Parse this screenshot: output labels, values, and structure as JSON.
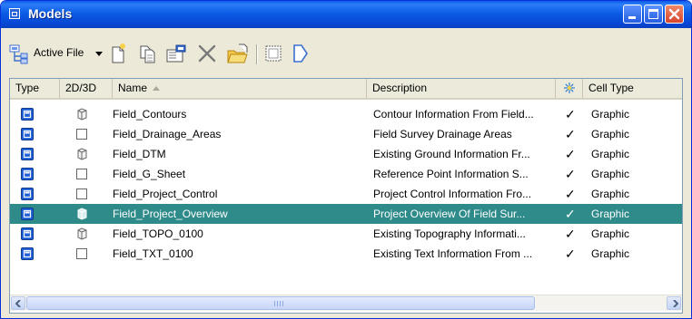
{
  "window": {
    "title": "Models"
  },
  "toolbar": {
    "active_file_label": "Active File"
  },
  "columns": {
    "type": "Type",
    "dim": "2D/3D",
    "name": "Name",
    "description": "Description",
    "cell_type": "Cell Type"
  },
  "rows": [
    {
      "dim": "3d",
      "name": "Field_Contours",
      "description": "Contour Information From Field...",
      "check": "✓",
      "cell_type": "Graphic",
      "selected": false
    },
    {
      "dim": "2d",
      "name": "Field_Drainage_Areas",
      "description": "Field Survey Drainage Areas",
      "check": "✓",
      "cell_type": "Graphic",
      "selected": false
    },
    {
      "dim": "3d",
      "name": "Field_DTM",
      "description": "Existing Ground Information Fr...",
      "check": "✓",
      "cell_type": "Graphic",
      "selected": false
    },
    {
      "dim": "2d",
      "name": "Field_G_Sheet",
      "description": "Reference Point Information S...",
      "check": "✓",
      "cell_type": "Graphic",
      "selected": false
    },
    {
      "dim": "2d",
      "name": "Field_Project_Control",
      "description": "Project Control Information Fro...",
      "check": "✓",
      "cell_type": "Graphic",
      "selected": false
    },
    {
      "dim": "3d",
      "name": "Field_Project_Overview",
      "description": "Project Overview Of Field Sur...",
      "check": "✓",
      "cell_type": "Graphic",
      "selected": true
    },
    {
      "dim": "3d",
      "name": "Field_TOPO_0100",
      "description": "Existing Topography Informati...",
      "check": "✓",
      "cell_type": "Graphic",
      "selected": false
    },
    {
      "dim": "2d",
      "name": "Field_TXT_0100",
      "description": "Existing Text Information From ...",
      "check": "✓",
      "cell_type": "Graphic",
      "selected": false
    }
  ],
  "colors": {
    "title_bar": "#0a5ae8",
    "selection": "#2f8a8a",
    "model_icon": "#1f5fd6"
  },
  "icons": [
    "models-app-icon",
    "minimize-icon",
    "maximize-icon",
    "close-icon",
    "active-file-icon",
    "new-model-icon",
    "copy-model-icon",
    "model-properties-icon",
    "delete-icon",
    "import-icon",
    "frame-icon",
    "flag-icon",
    "sort-ascending-icon",
    "display-column-icon",
    "model-type-icon",
    "cube-3d-icon",
    "square-2d-icon",
    "scroll-left-icon",
    "scroll-right-icon"
  ]
}
